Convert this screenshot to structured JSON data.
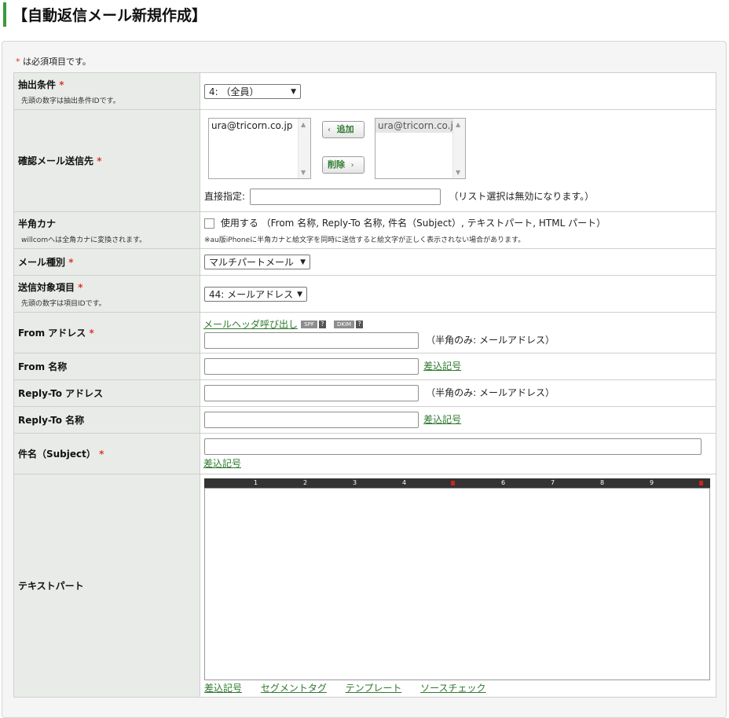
{
  "page": {
    "title": "【自動返信メール新規作成】"
  },
  "form": {
    "required_mark": "*",
    "required_note": "は必須項目です。",
    "extraction": {
      "label": "抽出条件",
      "sub": "先頭の数字は抽出条件IDです。",
      "selected": "4: （全員）"
    },
    "confirm": {
      "label": "確認メール送信先",
      "available": [
        "ura@tricorn.co.jp"
      ],
      "selected": [
        "ura@tricorn.co.jp"
      ],
      "add_label": "追加",
      "remove_label": "削除",
      "direct_label": "直接指定:",
      "direct_value": "",
      "direct_note": "（リスト選択は無効になります。）"
    },
    "kana": {
      "label": "半角カナ",
      "sub": "willcomへは全角カナに変換されます。",
      "checkbox_label": "使用する （From 名称, Reply-To 名称, 件名（Subject）, テキストパート, HTML パート）",
      "note": "※au版iPhoneに半角カナと絵文字を同時に送信すると絵文字が正しく表示されない場合があります。"
    },
    "mail_type": {
      "label": "メール種別",
      "selected": "マルチパートメール"
    },
    "target_item": {
      "label": "送信対象項目",
      "sub": "先頭の数字は項目IDです。",
      "selected": "44: メールアドレス"
    },
    "from_address": {
      "label": "From アドレス",
      "header_link": "メールヘッダ呼び出し",
      "spf": "SPF",
      "dkim": "DKIM",
      "help": "?",
      "value": "",
      "note": "（半角のみ: メールアドレス）"
    },
    "from_name": {
      "label": "From 名称",
      "value": "",
      "insert_link": "差込記号"
    },
    "reply_address": {
      "label": "Reply-To アドレス",
      "value": "",
      "note": "（半角のみ: メールアドレス）"
    },
    "reply_name": {
      "label": "Reply-To 名称",
      "value": "",
      "insert_link": "差込記号"
    },
    "subject": {
      "label": "件名（Subject）",
      "value": "",
      "insert_link": "差込記号"
    },
    "text_part": {
      "label": "テキストパート",
      "ruler": [
        "1",
        "2",
        "3",
        "4",
        "5",
        "6",
        "7",
        "8",
        "9"
      ],
      "body": "",
      "links": [
        "差込記号",
        "セグメントタグ",
        "テンプレート",
        "ソースチェック"
      ]
    }
  }
}
